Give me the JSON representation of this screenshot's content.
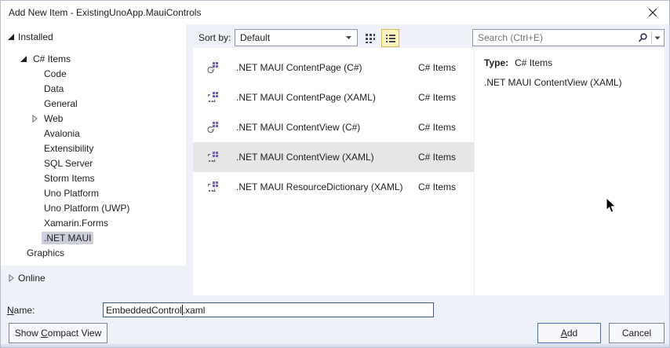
{
  "window": {
    "title": "Add New Item - ExistingUnoApp.MauiControls"
  },
  "left_nav": {
    "installed": {
      "label": "Installed",
      "expanded": true
    },
    "tree": [
      {
        "label": "C# Items",
        "indent": 24,
        "expander": "expanded"
      },
      {
        "label": "Code",
        "indent": 38,
        "expander": "none"
      },
      {
        "label": "Data",
        "indent": 38,
        "expander": "none"
      },
      {
        "label": "General",
        "indent": 38,
        "expander": "none"
      },
      {
        "label": "Web",
        "indent": 38,
        "expander": "collapsed"
      },
      {
        "label": "Avalonia",
        "indent": 38,
        "expander": "none"
      },
      {
        "label": "Extensibility",
        "indent": 38,
        "expander": "none"
      },
      {
        "label": "SQL Server",
        "indent": 38,
        "expander": "none"
      },
      {
        "label": "Storm Items",
        "indent": 38,
        "expander": "none"
      },
      {
        "label": "Uno Platform",
        "indent": 38,
        "expander": "none"
      },
      {
        "label": "Uno Platform (UWP)",
        "indent": 38,
        "expander": "none"
      },
      {
        "label": "Xamarin.Forms",
        "indent": 38,
        "expander": "none"
      },
      {
        "label": ".NET MAUI",
        "indent": 38,
        "expander": "none",
        "selected": true
      },
      {
        "label": "Graphics",
        "indent": 30,
        "expander": "hidden"
      }
    ],
    "online": {
      "label": "Online",
      "expanded": false
    }
  },
  "toolbar": {
    "sort_label": "Sort by:",
    "sort_value": "Default",
    "view_small_icons": "small-icons-view",
    "view_list": "list-view",
    "active_view": "list-view"
  },
  "search": {
    "placeholder": "Search (Ctrl+E)"
  },
  "templates": [
    {
      "name": ".NET MAUI ContentPage (C#)",
      "category": "C# Items",
      "icon": "maui-cs"
    },
    {
      "name": ".NET MAUI ContentPage (XAML)",
      "category": "C# Items",
      "icon": "maui-xaml"
    },
    {
      "name": ".NET MAUI ContentView (C#)",
      "category": "C# Items",
      "icon": "maui-cs"
    },
    {
      "name": ".NET MAUI ContentView (XAML)",
      "category": "C# Items",
      "icon": "maui-xaml",
      "selected": true
    },
    {
      "name": ".NET MAUI ResourceDictionary (XAML)",
      "category": "C# Items",
      "icon": "maui-xaml"
    }
  ],
  "details": {
    "type_label": "Type:",
    "type_value": "C# Items",
    "description": ".NET MAUI ContentView (XAML)"
  },
  "name_field": {
    "label": "Name:",
    "mnemonic": "N",
    "value": "EmbeddedControl.xaml",
    "value_before_caret": "EmbeddedControl",
    "value_after_caret": ".xaml"
  },
  "buttons": {
    "compact": "Show Compact View",
    "compact_mnemonic": "C",
    "add": "Add",
    "add_mnemonic": "A",
    "cancel": "Cancel"
  },
  "colors": {
    "dialog_bg": "#eef1f8",
    "panel_bg": "#ffffff",
    "tree_selection": "#cccedb",
    "row_selection": "#e6e6e6",
    "view_toggle_active_bg": "#fdf4bf",
    "view_toggle_active_border": "#d9b550",
    "default_button_border": "#3f6db5",
    "focused_input_border": "#3c5a9e",
    "template_icon_purple": "#6e5fc0"
  }
}
